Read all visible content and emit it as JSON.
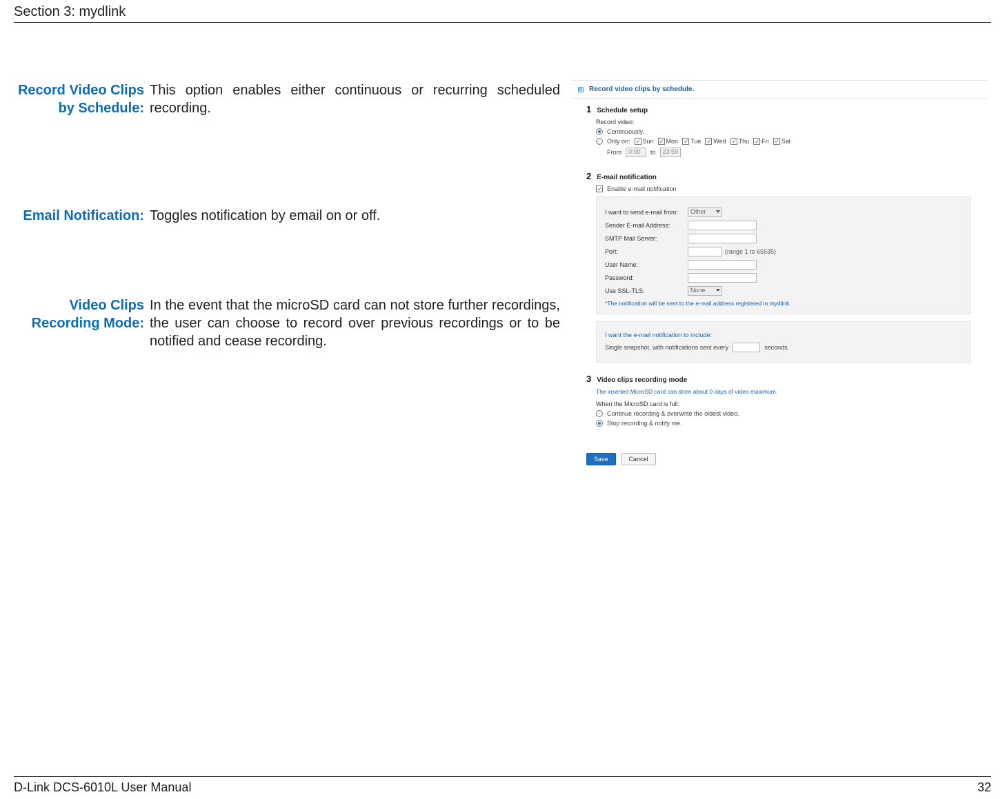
{
  "header": {
    "section": "Section 3: mydlink"
  },
  "footer": {
    "manual": "D-Link DCS-6010L User Manual",
    "page": "32"
  },
  "defs": {
    "row1": {
      "label": "Record Video Clips by Schedule:",
      "body": "This option enables either continuous or recurring scheduled recording."
    },
    "row2": {
      "label": "Email Notification:",
      "body": "Toggles notification by email on or off."
    },
    "row3": {
      "label": "Video Clips Recording Mode:",
      "body": "In the event that the microSD card can not store further recordings, the user can choose to record over previous recordings or to be notified and cease recording."
    }
  },
  "panel": {
    "title": "Record video clips by schedule.",
    "s1": {
      "num": "1",
      "title": "Schedule setup",
      "record_label": "Record video:",
      "opt_cont": "Continuously.",
      "opt_only": "Only on:",
      "days": {
        "sun": "Sun",
        "mon": "Mon",
        "tue": "Tue",
        "wed": "Wed",
        "thu": "Thu",
        "fri": "Fri",
        "sat": "Sat"
      },
      "from": "From",
      "to": "to",
      "t_from": "0:00",
      "t_to": "23:59"
    },
    "s2": {
      "num": "2",
      "title": "E-mail notification",
      "enable": "Enable e-mail notification",
      "send_from": "I want to send e-mail from:",
      "send_from_sel": "Other",
      "sender": "Sender E-mail Address:",
      "smtp": "SMTP Mail Server:",
      "port": "Port:",
      "port_hint": "(range 1 to 65535)",
      "user": "User Name:",
      "pass": "Password:",
      "ssl": "Use SSL-TLS:",
      "ssl_sel": "None",
      "note": "*The notification will be sent to the e-mail address registered in mydlink.",
      "inc_label": "I want the e-mail notification to include:",
      "snap_a": "Single snapshot, with notifications sent every",
      "snap_b": "seconds."
    },
    "s3": {
      "num": "3",
      "title": "Video clips recording mode",
      "cap": "The inserted MicroSD card can store about 0 days of video maximum.",
      "full": "When the MicroSD card is full:",
      "opt_over": "Continue recording & overwrite the oldest video.",
      "opt_stop": "Stop recording & notify me."
    },
    "buttons": {
      "save": "Save",
      "cancel": "Cancel"
    }
  }
}
